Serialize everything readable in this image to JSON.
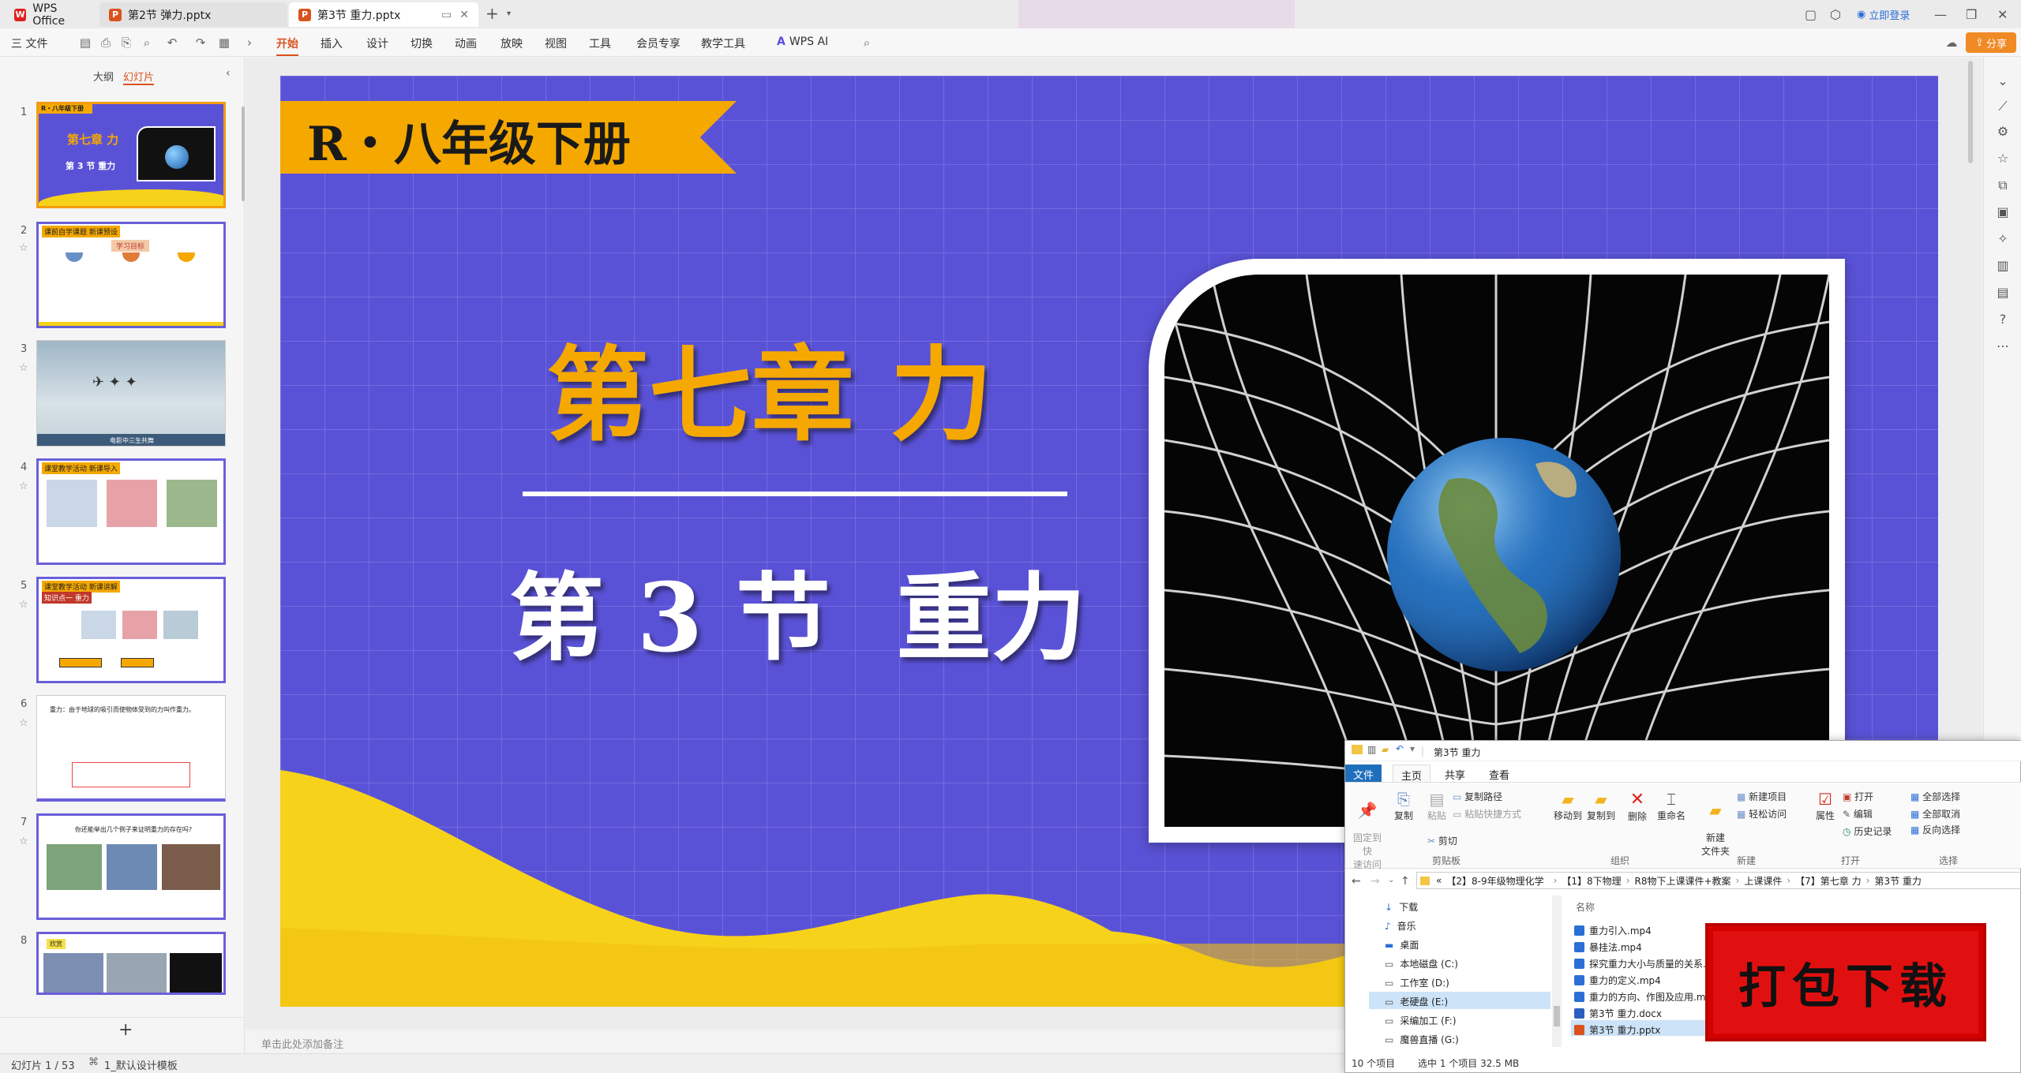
{
  "titlebar": {
    "tabs": [
      {
        "label": "WPS Office",
        "icon": "wps-logo-icon",
        "color": "#e02020"
      },
      {
        "label": "第2节 弹力.pptx",
        "icon": "ppt-file-icon",
        "color": "#d9531e"
      },
      {
        "label": "第3节 重力.pptx",
        "icon": "ppt-file-icon",
        "color": "#d9531e"
      }
    ],
    "add_tab": "+",
    "login": "立即登录"
  },
  "menubar": {
    "file_menu": "三 文件",
    "items": [
      "开始",
      "插入",
      "设计",
      "切换",
      "动画",
      "放映",
      "视图",
      "工具",
      "会员专享",
      "教学工具"
    ],
    "active": "开始",
    "ai_label": "WPS AI",
    "share_label": "分享"
  },
  "leftpanel": {
    "tabs": [
      "大纲",
      "幻灯片"
    ],
    "active_tab": "幻灯片",
    "slides": [
      {
        "num": "1",
        "title": "第七章 力",
        "subtitle": "第 3 节  重力",
        "tag": "R・八年级下册"
      },
      {
        "num": "2",
        "title": "课前自学课题 新课预设",
        "subtitle": "学习目标"
      },
      {
        "num": "3",
        "caption": "电影中三生共舞"
      },
      {
        "num": "4",
        "title": "课堂教学活动 新课导入"
      },
      {
        "num": "5",
        "title": "课堂教学活动 新课讲解",
        "subtitle": "知识点一  重力"
      },
      {
        "num": "6",
        "title": "重力：由于地球的吸引而使物体受到的力叫作重力。"
      },
      {
        "num": "7",
        "title": "你还能举出几个例子来证明重力的存在吗?"
      },
      {
        "num": "8",
        "title": "欣赏"
      }
    ],
    "add_slide": "+"
  },
  "slide": {
    "banner": "R・八年级下册",
    "chapter": "第七章 力",
    "section": "第 3 节  重力",
    "colors": {
      "bg": "#5a52d6",
      "accent": "#f5a800",
      "wave": "#f7d21a"
    }
  },
  "notes_placeholder": "单击此处添加备注",
  "statusbar": {
    "slide_count": "幻灯片 1 / 53",
    "template": "1_默认设计模板"
  },
  "explorer": {
    "title": "第3节 重力",
    "ribbon_tabs": [
      "文件",
      "主页",
      "共享",
      "查看"
    ],
    "ribbon": {
      "pin": "固定到快\n速访问",
      "copy": "复制",
      "paste": "粘贴",
      "copy_path": "复制路径",
      "paste_shortcut": "粘贴快捷方式",
      "cut": "剪切",
      "clipboard_group": "剪贴板",
      "move_to": "移动到",
      "copy_to": "复制到",
      "delete": "删除",
      "rename": "重命名",
      "organize_group": "组织",
      "new_folder": "新建\n文件夹",
      "new_item": "新建项目",
      "easy_access": "轻松访问",
      "new_group": "新建",
      "properties": "属性",
      "open": "打开",
      "edit": "编辑",
      "history": "历史记录",
      "open_group": "打开",
      "select_all": "全部选择",
      "select_none": "全部取消",
      "invert": "反向选择",
      "select_group": "选择"
    },
    "breadcrumb": [
      "«",
      "【2】8-9年级物理化学",
      "【1】8下物理",
      "R8物下上课课件+教案",
      "上课课件",
      "【7】第七章 力",
      "第3节 重力"
    ],
    "nav": [
      "下载",
      "音乐",
      "桌面",
      "本地磁盘 (C:)",
      "工作室 (D:)",
      "老硬盘 (E:)",
      "采编加工 (F:)",
      "魔兽直播 (G:)"
    ],
    "column_name": "名称",
    "files": [
      {
        "name": "重力引入.mp4",
        "type": "video"
      },
      {
        "name": "暴挂法.mp4",
        "type": "video"
      },
      {
        "name": "探究重力大小与质量的关系.mp4",
        "type": "video"
      },
      {
        "name": "重力的定义.mp4",
        "type": "video"
      },
      {
        "name": "重力的方向、作图及应用.mp4",
        "type": "video"
      },
      {
        "name": "第3节  重力.docx",
        "type": "doc"
      },
      {
        "name": "第3节 重力.pptx",
        "type": "ppt"
      }
    ],
    "status_items": "10 个项目",
    "status_selected": "选中 1 个项目  32.5 MB"
  },
  "stamp": {
    "text": "打包下载"
  }
}
